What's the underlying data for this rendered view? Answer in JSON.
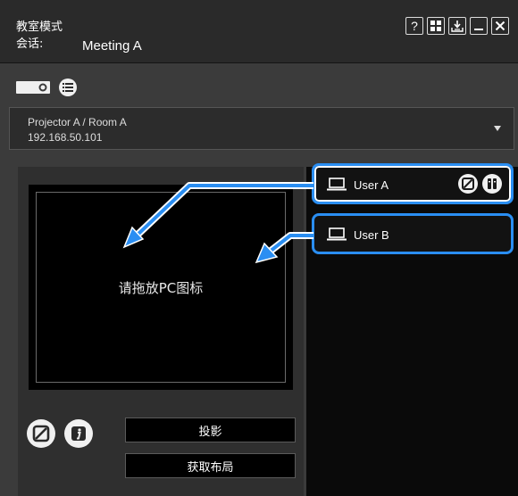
{
  "header": {
    "mode_title": "教室模式",
    "session_label": "会话:",
    "session_name": "Meeting A",
    "buttons": [
      "help",
      "layout-grid",
      "download",
      "minimize",
      "close"
    ],
    "help_glyph": "?"
  },
  "toolbar_icons": [
    "projector-icon",
    "list-icon"
  ],
  "projector": {
    "name": "Projector A / Room A",
    "ip": "192.168.50.101"
  },
  "drop_zone": {
    "hint": "请拖放PC图标"
  },
  "controls": {
    "project_label": "投影",
    "get_layout_label": "获取布局"
  },
  "users": [
    {
      "name": "User A"
    },
    {
      "name": "User B"
    }
  ],
  "colors": {
    "accent": "#2a8ef2",
    "background": "#3b3b3b",
    "panel_dark": "#0a0a0a",
    "header": "#2a2a2a"
  }
}
